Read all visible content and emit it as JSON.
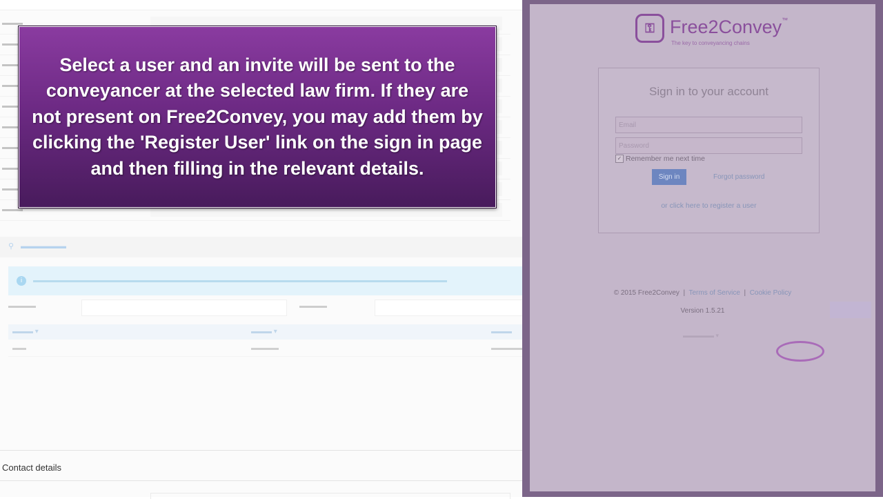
{
  "banner": {
    "text": "Select a user and an invite will be sent to the conveyancer at the selected law firm. If they are not present on Free2Convey, you may add them by clicking the 'Register User' link on the sign in page and then filling in the relevant details."
  },
  "background": {
    "section_title": "Contact details"
  },
  "signin": {
    "logo_name": "Free2Convey",
    "logo_tagline": "The key to conveyancing chains",
    "title": "Sign in to your account",
    "email_placeholder": "Email",
    "password_placeholder": "Password",
    "remember_label": "Remember me next time",
    "remember_checked": true,
    "signin_label": "Sign in",
    "forgot_label": "Forgot password",
    "register_label": "or click here to register a user",
    "footer": {
      "copyright": "© 2015 Free2Convey",
      "separator": "|",
      "terms": "Terms of Service",
      "cookie": "Cookie Policy"
    },
    "version": "Version 1.5.21"
  },
  "colors": {
    "banner_top": "#8a3ba0",
    "banner_bottom": "#481b5c",
    "popup_frame": "#7c6589",
    "popup_bg": "#beaec4",
    "brand_purple": "#8a4f9c",
    "signin_button": "#6d86c0"
  }
}
